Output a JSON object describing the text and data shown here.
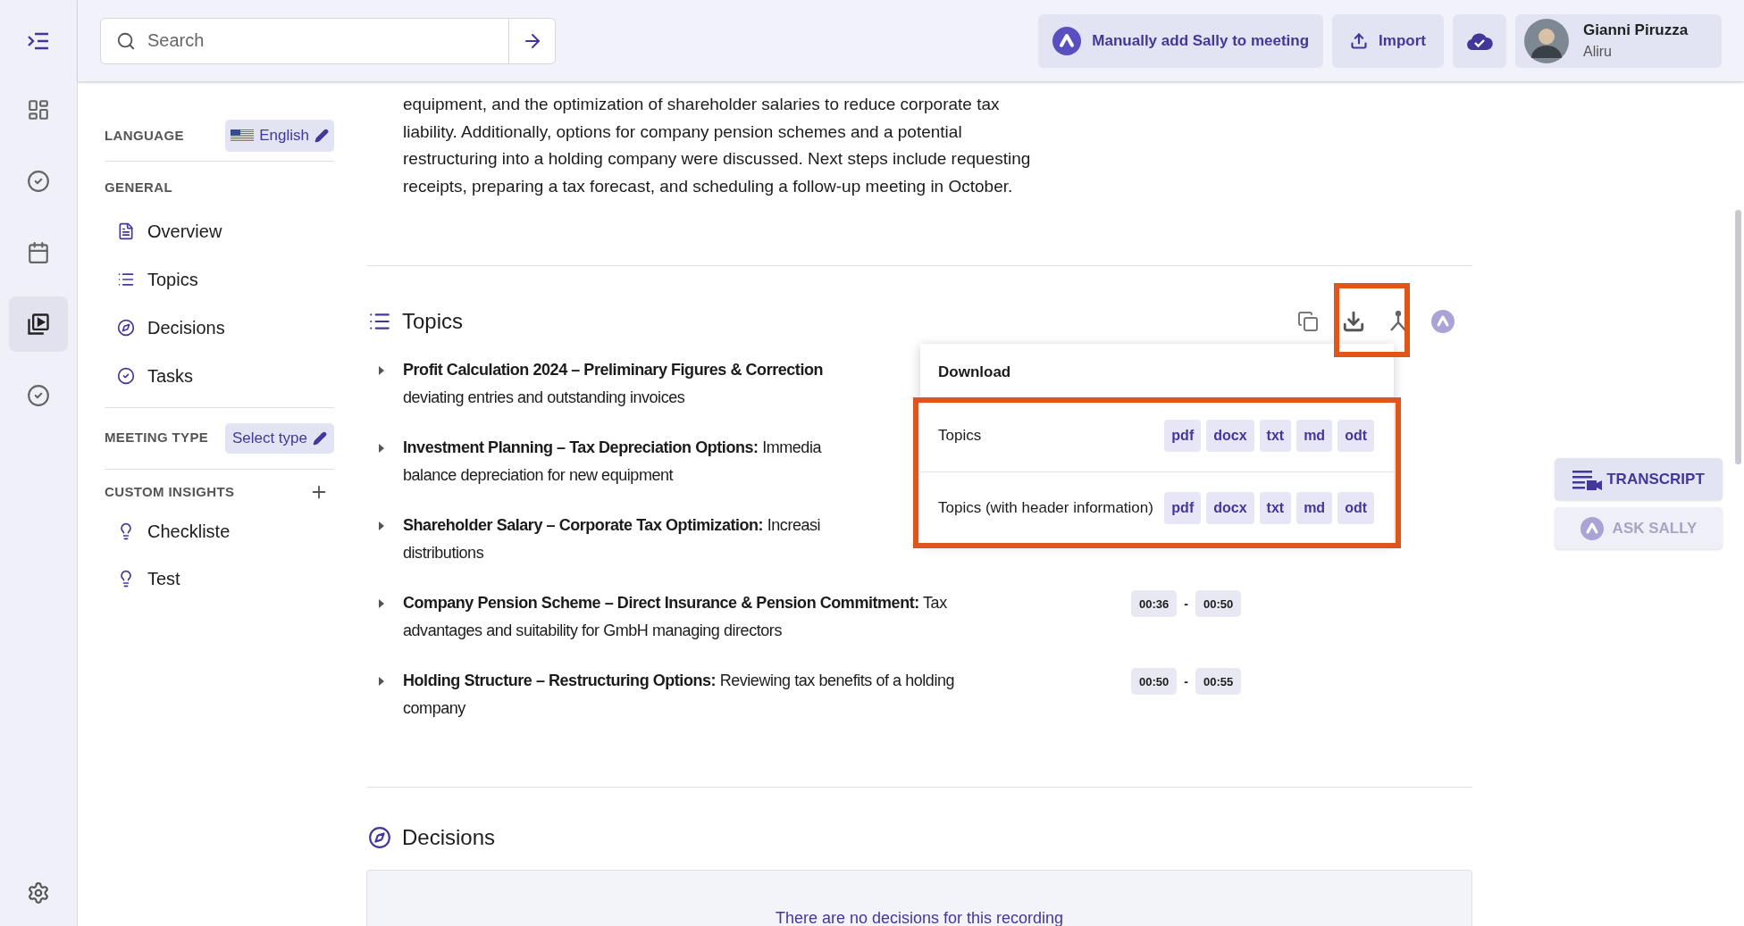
{
  "rail": {
    "items": [
      {
        "kind": "dashboard",
        "selected": false
      },
      {
        "kind": "check",
        "selected": false
      },
      {
        "kind": "calendar",
        "selected": false
      },
      {
        "kind": "recordings",
        "selected": true
      },
      {
        "kind": "check",
        "selected": false
      }
    ]
  },
  "search": {
    "placeholder": "Search"
  },
  "header_actions": {
    "add_sally": "Manually add Sally to meeting",
    "import": "Import"
  },
  "user": {
    "name": "Gianni Piruzza",
    "org": "Aliru"
  },
  "panel": {
    "language": {
      "label": "LANGUAGE",
      "value": "English"
    },
    "general": {
      "label": "GENERAL",
      "items": [
        {
          "kind": "overview",
          "label": "Overview"
        },
        {
          "kind": "topics",
          "label": "Topics"
        },
        {
          "kind": "decisions",
          "label": "Decisions"
        },
        {
          "kind": "tasks",
          "label": "Tasks"
        }
      ]
    },
    "meeting_type": {
      "label": "MEETING TYPE",
      "value": "Select type"
    },
    "custom_insights": {
      "label": "CUSTOM INSIGHTS",
      "items": [
        {
          "label": "Checkliste"
        },
        {
          "label": "Test"
        }
      ]
    }
  },
  "summary_lines": [
    "equipment, and the optimization of shareholder salaries to reduce corporate tax",
    "liability. Additionally, options for company pension schemes and a potential",
    "restructuring into a holding company were discussed. Next steps include requesting",
    "receipts, preparing a tax forecast, and scheduling a follow-up meeting in October."
  ],
  "topics_section": {
    "title": "Topics",
    "items": [
      {
        "lines": [
          "**Profit Calculation 2024 – Preliminary Figures & Correction**",
          "deviating entries and outstanding invoices"
        ]
      },
      {
        "lines": [
          "**Investment Planning – Tax Depreciation Options:** Immedia",
          "balance depreciation for new equipment"
        ]
      },
      {
        "lines": [
          "**Shareholder Salary – Corporate Tax Optimization:** Increasi",
          "distributions"
        ]
      },
      {
        "lines": [
          "**Company Pension Scheme – Direct Insurance & Pension Commitment:** Tax",
          "advantages and suitability for GmbH managing directors"
        ],
        "start": "00:36",
        "separator": "-",
        "end": "00:50"
      },
      {
        "lines": [
          "**Holding Structure – Restructuring Options:** Reviewing tax benefits of a holding",
          "company"
        ],
        "start": "00:50",
        "separator": "-",
        "end": "00:55"
      }
    ]
  },
  "download_menu": {
    "title": "Download",
    "rows": [
      {
        "label": "Topics",
        "formats": [
          "pdf",
          "docx",
          "txt",
          "md",
          "odt"
        ]
      },
      {
        "label": "Topics (with header information)",
        "formats": [
          "pdf",
          "docx",
          "txt",
          "md",
          "odt"
        ]
      }
    ]
  },
  "side_buttons": {
    "transcript": "TRANSCRIPT",
    "ask_sally": {
      "label": "ASK SALLY",
      "disabled": true
    }
  },
  "decisions": {
    "title": "Decisions",
    "empty_text": "There are no decisions for this recording"
  }
}
